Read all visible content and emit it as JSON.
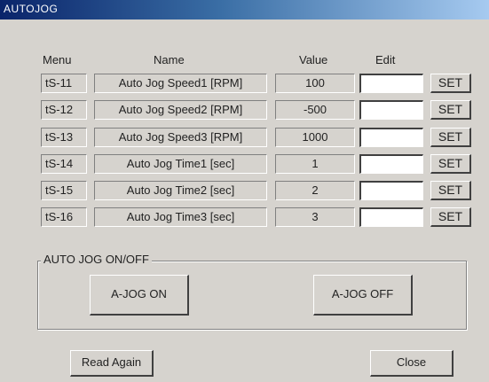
{
  "window": {
    "title": "AUTOJOG"
  },
  "headers": {
    "menu": "Menu",
    "name": "Name",
    "value": "Value",
    "edit": "Edit"
  },
  "rows": [
    {
      "menu": "tS-11",
      "name": "Auto Jog Speed1 [RPM]",
      "value": "100",
      "edit": "",
      "set": "SET"
    },
    {
      "menu": "tS-12",
      "name": "Auto Jog Speed2 [RPM]",
      "value": "-500",
      "edit": "",
      "set": "SET"
    },
    {
      "menu": "tS-13",
      "name": "Auto Jog Speed3 [RPM]",
      "value": "1000",
      "edit": "",
      "set": "SET"
    },
    {
      "menu": "tS-14",
      "name": "Auto Jog Time1 [sec]",
      "value": "1",
      "edit": "",
      "set": "SET"
    },
    {
      "menu": "tS-15",
      "name": "Auto Jog Time2 [sec]",
      "value": "2",
      "edit": "",
      "set": "SET"
    },
    {
      "menu": "tS-16",
      "name": "Auto Jog Time3 [sec]",
      "value": "3",
      "edit": "",
      "set": "SET"
    }
  ],
  "group": {
    "label": "AUTO JOG ON/OFF",
    "on_label": "A-JOG ON",
    "off_label": "A-JOG OFF"
  },
  "footer": {
    "read_again": "Read Again",
    "close": "Close"
  }
}
